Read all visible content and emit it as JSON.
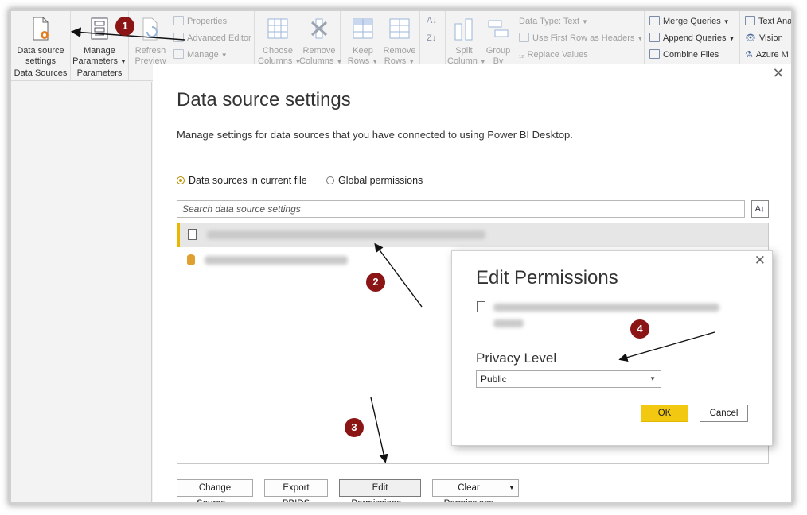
{
  "ribbon": {
    "data_source_settings": {
      "line1": "Data source",
      "line2": "settings"
    },
    "manage_parameters": {
      "line1": "Manage",
      "line2": "Parameters"
    },
    "refresh_preview": {
      "line1": "Refresh",
      "line2": "Preview"
    },
    "properties": "Properties",
    "advanced_editor": "Advanced Editor",
    "manage": "Manage",
    "choose_columns": {
      "line1": "Choose",
      "line2": "Columns"
    },
    "remove_columns": {
      "line1": "Remove",
      "line2": "Columns"
    },
    "keep_rows": {
      "line1": "Keep",
      "line2": "Rows"
    },
    "remove_rows": {
      "line1": "Remove",
      "line2": "Rows"
    },
    "split_column": {
      "line1": "Split",
      "line2": "Column"
    },
    "group_by": {
      "line1": "Group",
      "line2": "By"
    },
    "data_type": "Data Type: Text",
    "use_first_row": "Use First Row as Headers",
    "replace_values": "Replace Values",
    "merge_queries": "Merge Queries",
    "append_queries": "Append Queries",
    "combine_files": "Combine Files",
    "text_analytics": "Text Ana",
    "vision": "Vision",
    "azure_ml": "Azure M",
    "group_data_sources": "Data Sources",
    "group_parameters": "Parameters"
  },
  "dialog": {
    "title": "Data source settings",
    "subtitle": "Manage settings for data sources that you have connected to using Power BI Desktop.",
    "radio_current": "Data sources in current file",
    "radio_global": "Global permissions",
    "search_placeholder": "Search data source settings",
    "buttons": {
      "change_source": "Change Source...",
      "export_pbids": "Export PBIDS",
      "edit_permissions": "Edit Permissions...",
      "clear_permissions": "Clear Permissions"
    }
  },
  "edit_permissions": {
    "title": "Edit Permissions",
    "privacy_label": "Privacy Level",
    "privacy_value": "Public",
    "ok": "OK",
    "cancel": "Cancel"
  },
  "annotations": {
    "b1": "1",
    "b2": "2",
    "b3": "3",
    "b4": "4"
  },
  "colors": {
    "accent": "#f2c811",
    "badge": "#8b1414"
  }
}
